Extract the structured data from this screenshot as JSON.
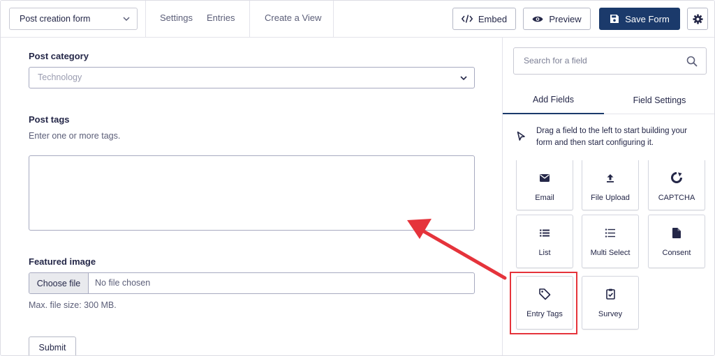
{
  "toolbar": {
    "form_selector": "Post creation form",
    "nav": [
      "Settings",
      "Entries",
      "Create a View"
    ],
    "embed_label": "Embed",
    "preview_label": "Preview",
    "save_label": "Save Form"
  },
  "form": {
    "post_category": {
      "label": "Post category",
      "placeholder": "Technology"
    },
    "post_tags": {
      "label": "Post tags",
      "help": "Enter one or more tags."
    },
    "featured_image": {
      "label": "Featured image",
      "button": "Choose file",
      "status": "No file chosen",
      "help": "Max. file size: 300 MB."
    },
    "submit_label": "Submit"
  },
  "panel": {
    "search_placeholder": "Search for a field",
    "tabs": [
      "Add Fields",
      "Field Settings"
    ],
    "active_tab": "Add Fields",
    "hint": "Drag a field to the left to start building your form and then start configuring it.",
    "fields": [
      {
        "name": "Email",
        "icon": "envelope-icon"
      },
      {
        "name": "File Upload",
        "icon": "upload-icon"
      },
      {
        "name": "CAPTCHA",
        "icon": "captcha-icon"
      },
      {
        "name": "List",
        "icon": "list-icon"
      },
      {
        "name": "Multi Select",
        "icon": "multi-select-icon"
      },
      {
        "name": "Consent",
        "icon": "document-icon"
      },
      {
        "name": "Entry Tags",
        "icon": "tag-icon"
      },
      {
        "name": "Survey",
        "icon": "clipboard-check-icon"
      }
    ],
    "highlighted_field": "Entry Tags"
  },
  "colors": {
    "primary": "#1b3a6b",
    "highlight": "#e5333b",
    "text": "#242748"
  }
}
